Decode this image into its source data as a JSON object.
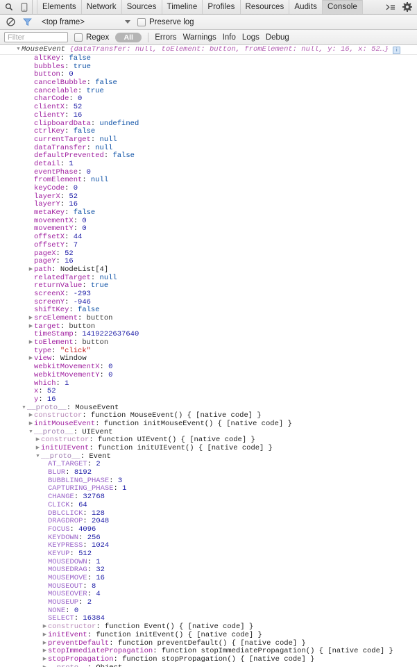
{
  "tabbar": {
    "icons": [
      {
        "name": "inspect-element-icon",
        "glyph": "search"
      },
      {
        "name": "device-toolbar-icon",
        "glyph": "device"
      }
    ],
    "tabs": [
      {
        "label": "Elements",
        "active": false
      },
      {
        "label": "Network",
        "active": false
      },
      {
        "label": "Sources",
        "active": false
      },
      {
        "label": "Timeline",
        "active": false
      },
      {
        "label": "Profiles",
        "active": false
      },
      {
        "label": "Resources",
        "active": false
      },
      {
        "label": "Audits",
        "active": false
      },
      {
        "label": "Console",
        "active": true
      }
    ],
    "right_icons": [
      {
        "name": "drawer-toggle-icon",
        "glyph": "≻≡"
      },
      {
        "name": "gear-icon",
        "glyph": "gear"
      }
    ]
  },
  "toolbar": {
    "clear_console_icon": "clear-console-icon",
    "filter_icon": "filter-funnel-icon",
    "frame_selector_value": "<top frame>",
    "preserve_log_label": "Preserve log",
    "preserve_log_checked": false
  },
  "filterbar": {
    "filter_placeholder": "Filter",
    "filter_value": "",
    "regex_label": "Regex",
    "regex_checked": false,
    "levels": [
      {
        "label": "All",
        "active": true
      },
      {
        "label": "Errors",
        "active": false
      },
      {
        "label": "Warnings",
        "active": false
      },
      {
        "label": "Info",
        "active": false
      },
      {
        "label": "Logs",
        "active": false
      },
      {
        "label": "Debug",
        "active": false
      }
    ]
  },
  "console": {
    "header": {
      "type_name": "MouseEvent",
      "preview": " {dataTransfer: null, toElement: button, fromElement: null, y: 16, x: 52…}",
      "badge": "i"
    },
    "rows": [
      {
        "indent": 1,
        "tri": "none",
        "key": "altKey",
        "key_class": "k",
        "val": "false",
        "val_class": "v-bool"
      },
      {
        "indent": 1,
        "tri": "none",
        "key": "bubbles",
        "key_class": "k",
        "val": "true",
        "val_class": "v-bool"
      },
      {
        "indent": 1,
        "tri": "none",
        "key": "button",
        "key_class": "k",
        "val": "0",
        "val_class": "v-num"
      },
      {
        "indent": 1,
        "tri": "none",
        "key": "cancelBubble",
        "key_class": "k",
        "val": "false",
        "val_class": "v-bool"
      },
      {
        "indent": 1,
        "tri": "none",
        "key": "cancelable",
        "key_class": "k",
        "val": "true",
        "val_class": "v-bool"
      },
      {
        "indent": 1,
        "tri": "none",
        "key": "charCode",
        "key_class": "k",
        "val": "0",
        "val_class": "v-num"
      },
      {
        "indent": 1,
        "tri": "none",
        "key": "clientX",
        "key_class": "k",
        "val": "52",
        "val_class": "v-num"
      },
      {
        "indent": 1,
        "tri": "none",
        "key": "clientY",
        "key_class": "k",
        "val": "16",
        "val_class": "v-num"
      },
      {
        "indent": 1,
        "tri": "none",
        "key": "clipboardData",
        "key_class": "k",
        "val": "undefined",
        "val_class": "v-bool"
      },
      {
        "indent": 1,
        "tri": "none",
        "key": "ctrlKey",
        "key_class": "k",
        "val": "false",
        "val_class": "v-bool"
      },
      {
        "indent": 1,
        "tri": "none",
        "key": "currentTarget",
        "key_class": "k",
        "val": "null",
        "val_class": "v-bool"
      },
      {
        "indent": 1,
        "tri": "none",
        "key": "dataTransfer",
        "key_class": "k",
        "val": "null",
        "val_class": "v-bool"
      },
      {
        "indent": 1,
        "tri": "none",
        "key": "defaultPrevented",
        "key_class": "k",
        "val": "false",
        "val_class": "v-bool"
      },
      {
        "indent": 1,
        "tri": "none",
        "key": "detail",
        "key_class": "k",
        "val": "1",
        "val_class": "v-num"
      },
      {
        "indent": 1,
        "tri": "none",
        "key": "eventPhase",
        "key_class": "k",
        "val": "0",
        "val_class": "v-num"
      },
      {
        "indent": 1,
        "tri": "none",
        "key": "fromElement",
        "key_class": "k",
        "val": "null",
        "val_class": "v-bool"
      },
      {
        "indent": 1,
        "tri": "none",
        "key": "keyCode",
        "key_class": "k",
        "val": "0",
        "val_class": "v-num"
      },
      {
        "indent": 1,
        "tri": "none",
        "key": "layerX",
        "key_class": "k",
        "val": "52",
        "val_class": "v-num"
      },
      {
        "indent": 1,
        "tri": "none",
        "key": "layerY",
        "key_class": "k",
        "val": "16",
        "val_class": "v-num"
      },
      {
        "indent": 1,
        "tri": "none",
        "key": "metaKey",
        "key_class": "k",
        "val": "false",
        "val_class": "v-bool"
      },
      {
        "indent": 1,
        "tri": "none",
        "key": "movementX",
        "key_class": "k",
        "val": "0",
        "val_class": "v-num"
      },
      {
        "indent": 1,
        "tri": "none",
        "key": "movementY",
        "key_class": "k",
        "val": "0",
        "val_class": "v-num"
      },
      {
        "indent": 1,
        "tri": "none",
        "key": "offsetX",
        "key_class": "k",
        "val": "44",
        "val_class": "v-num"
      },
      {
        "indent": 1,
        "tri": "none",
        "key": "offsetY",
        "key_class": "k",
        "val": "7",
        "val_class": "v-num"
      },
      {
        "indent": 1,
        "tri": "none",
        "key": "pageX",
        "key_class": "k",
        "val": "52",
        "val_class": "v-num"
      },
      {
        "indent": 1,
        "tri": "none",
        "key": "pageY",
        "key_class": "k",
        "val": "16",
        "val_class": "v-num"
      },
      {
        "indent": 1,
        "tri": "collapsed",
        "key": "path",
        "key_class": "k",
        "val": "NodeList[4]",
        "val_class": "v-obj"
      },
      {
        "indent": 1,
        "tri": "none",
        "key": "relatedTarget",
        "key_class": "k",
        "val": "null",
        "val_class": "v-bool"
      },
      {
        "indent": 1,
        "tri": "none",
        "key": "returnValue",
        "key_class": "k",
        "val": "true",
        "val_class": "v-bool"
      },
      {
        "indent": 1,
        "tri": "none",
        "key": "screenX",
        "key_class": "k",
        "val": "-293",
        "val_class": "v-num"
      },
      {
        "indent": 1,
        "tri": "none",
        "key": "screenY",
        "key_class": "k",
        "val": "-946",
        "val_class": "v-num"
      },
      {
        "indent": 1,
        "tri": "none",
        "key": "shiftKey",
        "key_class": "k",
        "val": "false",
        "val_class": "v-bool"
      },
      {
        "indent": 1,
        "tri": "collapsed",
        "key": "srcElement",
        "key_class": "k",
        "val": "button",
        "val_class": "v-node"
      },
      {
        "indent": 1,
        "tri": "collapsed",
        "key": "target",
        "key_class": "k",
        "val": "button",
        "val_class": "v-node"
      },
      {
        "indent": 1,
        "tri": "none",
        "key": "timeStamp",
        "key_class": "k",
        "val": "1419222637640",
        "val_class": "v-num"
      },
      {
        "indent": 1,
        "tri": "collapsed",
        "key": "toElement",
        "key_class": "k",
        "val": "button",
        "val_class": "v-node"
      },
      {
        "indent": 1,
        "tri": "none",
        "key": "type",
        "key_class": "k",
        "val": "\"click\"",
        "val_class": "v-str"
      },
      {
        "indent": 1,
        "tri": "collapsed",
        "key": "view",
        "key_class": "k",
        "val": "Window",
        "val_class": "v-obj"
      },
      {
        "indent": 1,
        "tri": "none",
        "key": "webkitMovementX",
        "key_class": "k",
        "val": "0",
        "val_class": "v-num"
      },
      {
        "indent": 1,
        "tri": "none",
        "key": "webkitMovementY",
        "key_class": "k",
        "val": "0",
        "val_class": "v-num"
      },
      {
        "indent": 1,
        "tri": "none",
        "key": "which",
        "key_class": "k",
        "val": "1",
        "val_class": "v-num"
      },
      {
        "indent": 1,
        "tri": "none",
        "key": "x",
        "key_class": "k",
        "val": "52",
        "val_class": "v-num"
      },
      {
        "indent": 1,
        "tri": "none",
        "key": "y",
        "key_class": "k",
        "val": "16",
        "val_class": "v-num"
      },
      {
        "indent": 0,
        "tri": "expanded",
        "key": "__proto__",
        "key_class": "k-proto",
        "val": "MouseEvent",
        "val_class": "v-obj"
      },
      {
        "indent": 1,
        "tri": "collapsed",
        "key": "constructor",
        "key_class": "k-dim",
        "val": "function MouseEvent() { [native code] }",
        "val_class": "v-plain"
      },
      {
        "indent": 1,
        "tri": "collapsed",
        "key": "initMouseEvent",
        "key_class": "k",
        "val": "function initMouseEvent() { [native code] }",
        "val_class": "v-plain"
      },
      {
        "indent": 1,
        "tri": "expanded",
        "key": "__proto__",
        "key_class": "k-proto",
        "val": "UIEvent",
        "val_class": "v-obj"
      },
      {
        "indent": 2,
        "tri": "collapsed",
        "key": "constructor",
        "key_class": "k-dim",
        "val": "function UIEvent() { [native code] }",
        "val_class": "v-plain"
      },
      {
        "indent": 2,
        "tri": "collapsed",
        "key": "initUIEvent",
        "key_class": "k",
        "val": "function initUIEvent() { [native code] }",
        "val_class": "v-plain"
      },
      {
        "indent": 2,
        "tri": "expanded",
        "key": "__proto__",
        "key_class": "k-proto",
        "val": "Event",
        "val_class": "v-obj"
      },
      {
        "indent": 3,
        "tri": "none",
        "key": "AT_TARGET",
        "key_class": "k-const",
        "val": "2",
        "val_class": "v-num"
      },
      {
        "indent": 3,
        "tri": "none",
        "key": "BLUR",
        "key_class": "k-const",
        "val": "8192",
        "val_class": "v-num"
      },
      {
        "indent": 3,
        "tri": "none",
        "key": "BUBBLING_PHASE",
        "key_class": "k-const",
        "val": "3",
        "val_class": "v-num"
      },
      {
        "indent": 3,
        "tri": "none",
        "key": "CAPTURING_PHASE",
        "key_class": "k-const",
        "val": "1",
        "val_class": "v-num"
      },
      {
        "indent": 3,
        "tri": "none",
        "key": "CHANGE",
        "key_class": "k-const",
        "val": "32768",
        "val_class": "v-num"
      },
      {
        "indent": 3,
        "tri": "none",
        "key": "CLICK",
        "key_class": "k-const",
        "val": "64",
        "val_class": "v-num"
      },
      {
        "indent": 3,
        "tri": "none",
        "key": "DBLCLICK",
        "key_class": "k-const",
        "val": "128",
        "val_class": "v-num"
      },
      {
        "indent": 3,
        "tri": "none",
        "key": "DRAGDROP",
        "key_class": "k-const",
        "val": "2048",
        "val_class": "v-num"
      },
      {
        "indent": 3,
        "tri": "none",
        "key": "FOCUS",
        "key_class": "k-const",
        "val": "4096",
        "val_class": "v-num"
      },
      {
        "indent": 3,
        "tri": "none",
        "key": "KEYDOWN",
        "key_class": "k-const",
        "val": "256",
        "val_class": "v-num"
      },
      {
        "indent": 3,
        "tri": "none",
        "key": "KEYPRESS",
        "key_class": "k-const",
        "val": "1024",
        "val_class": "v-num"
      },
      {
        "indent": 3,
        "tri": "none",
        "key": "KEYUP",
        "key_class": "k-const",
        "val": "512",
        "val_class": "v-num"
      },
      {
        "indent": 3,
        "tri": "none",
        "key": "MOUSEDOWN",
        "key_class": "k-const",
        "val": "1",
        "val_class": "v-num"
      },
      {
        "indent": 3,
        "tri": "none",
        "key": "MOUSEDRAG",
        "key_class": "k-const",
        "val": "32",
        "val_class": "v-num"
      },
      {
        "indent": 3,
        "tri": "none",
        "key": "MOUSEMOVE",
        "key_class": "k-const",
        "val": "16",
        "val_class": "v-num"
      },
      {
        "indent": 3,
        "tri": "none",
        "key": "MOUSEOUT",
        "key_class": "k-const",
        "val": "8",
        "val_class": "v-num"
      },
      {
        "indent": 3,
        "tri": "none",
        "key": "MOUSEOVER",
        "key_class": "k-const",
        "val": "4",
        "val_class": "v-num"
      },
      {
        "indent": 3,
        "tri": "none",
        "key": "MOUSEUP",
        "key_class": "k-const",
        "val": "2",
        "val_class": "v-num"
      },
      {
        "indent": 3,
        "tri": "none",
        "key": "NONE",
        "key_class": "k-const",
        "val": "0",
        "val_class": "v-num"
      },
      {
        "indent": 3,
        "tri": "none",
        "key": "SELECT",
        "key_class": "k-const",
        "val": "16384",
        "val_class": "v-num"
      },
      {
        "indent": 3,
        "tri": "collapsed",
        "key": "constructor",
        "key_class": "k-dim",
        "val": "function Event() { [native code] }",
        "val_class": "v-plain"
      },
      {
        "indent": 3,
        "tri": "collapsed",
        "key": "initEvent",
        "key_class": "k",
        "val": "function initEvent() { [native code] }",
        "val_class": "v-plain"
      },
      {
        "indent": 3,
        "tri": "collapsed",
        "key": "preventDefault",
        "key_class": "k",
        "val": "function preventDefault() { [native code] }",
        "val_class": "v-plain"
      },
      {
        "indent": 3,
        "tri": "collapsed",
        "key": "stopImmediatePropagation",
        "key_class": "k",
        "val": "function stopImmediatePropagation() { [native code] }",
        "val_class": "v-plain"
      },
      {
        "indent": 3,
        "tri": "collapsed",
        "key": "stopPropagation",
        "key_class": "k",
        "val": "function stopPropagation() { [native code] }",
        "val_class": "v-plain"
      },
      {
        "indent": 3,
        "tri": "collapsed",
        "key": "__proto__",
        "key_class": "k-proto",
        "val": "Object",
        "val_class": "v-obj"
      }
    ]
  }
}
